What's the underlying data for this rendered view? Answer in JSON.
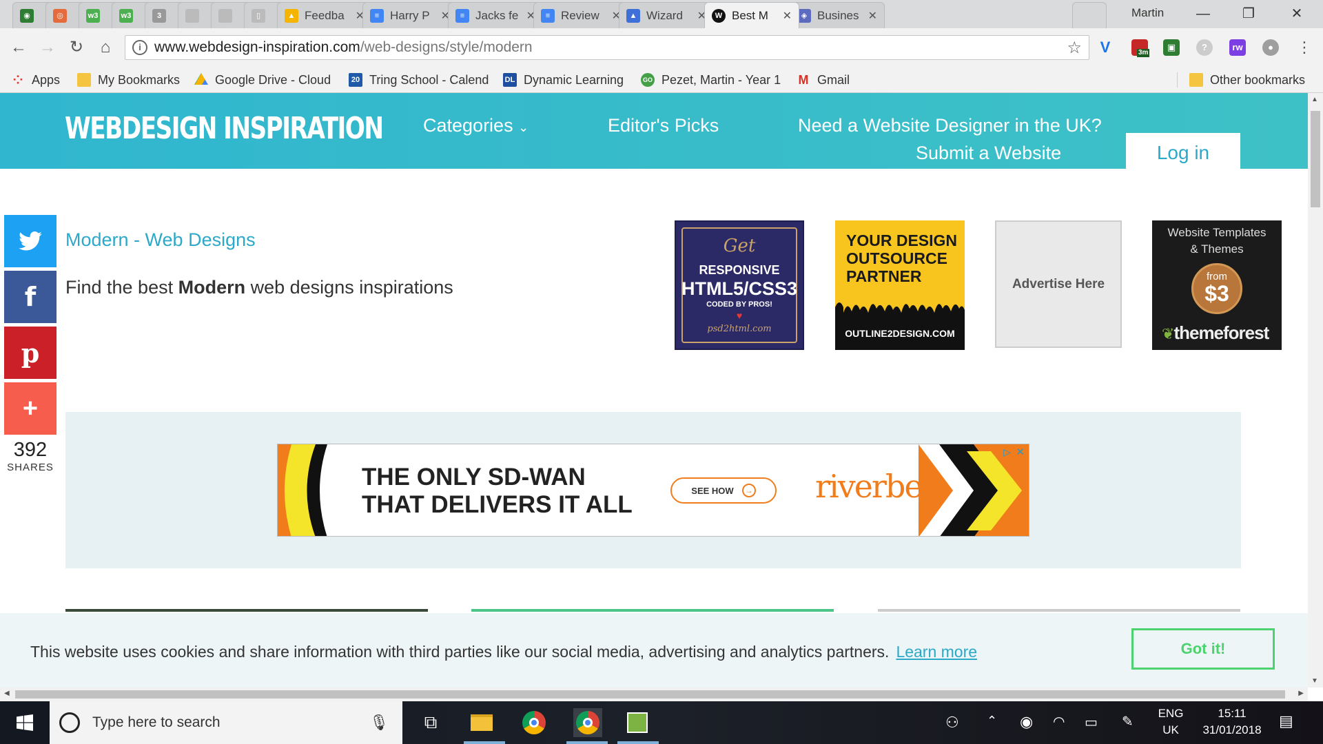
{
  "browser": {
    "tabs": [
      {
        "label": "",
        "fav": "green-person-icon",
        "color": "#2e7d32"
      },
      {
        "label": "",
        "fav": "swirl-icon",
        "color": "#e66b3c"
      },
      {
        "label": "",
        "fav": "w3-icon",
        "color": "#4caf50"
      },
      {
        "label": "",
        "fav": "w3-icon",
        "color": "#4caf50"
      },
      {
        "label": "",
        "fav": "css3-icon",
        "color": "#999999"
      },
      {
        "label": "",
        "fav": "blank-icon",
        "color": "#bbbbbb"
      },
      {
        "label": "",
        "fav": "blank-icon",
        "color": "#bbbbbb"
      },
      {
        "label": "",
        "fav": "page-icon",
        "color": "#bbbbbb"
      },
      {
        "label": "Feedba",
        "fav": "google-drive-icon",
        "color": "#f4b400"
      },
      {
        "label": "Harry P",
        "fav": "google-docs-icon",
        "color": "#4285f4"
      },
      {
        "label": "Jacks fe",
        "fav": "google-docs-icon",
        "color": "#4285f4"
      },
      {
        "label": "Review",
        "fav": "google-docs-icon",
        "color": "#4285f4"
      },
      {
        "label": "Wizard",
        "fav": "wizard-icon",
        "color": "#3f6fd8"
      },
      {
        "label": "Best M",
        "fav": "w-logo-icon",
        "color": "#111111"
      },
      {
        "label": "Busines",
        "fav": "business-icon",
        "color": "#5c6bc0"
      }
    ],
    "profile_name": "Martin",
    "url_host": "www.webdesign-inspiration.com",
    "url_path": "/web-designs/style/modern",
    "extension_badge": "3m",
    "bookmarks": [
      {
        "label": "Apps",
        "icon": "apps-grid-icon"
      },
      {
        "label": "My Bookmarks",
        "icon": "folder-icon"
      },
      {
        "label": "Google Drive - Cloud",
        "icon": "google-drive-icon"
      },
      {
        "label": "Tring School - Calend",
        "icon": "calendar-icon",
        "badge": "20"
      },
      {
        "label": "Dynamic Learning",
        "icon": "dl-icon",
        "badge": "DL"
      },
      {
        "label": "Pezet, Martin - Year 1",
        "icon": "go-icon",
        "badge": "GO"
      },
      {
        "label": "Gmail",
        "icon": "gmail-icon",
        "badge": "M"
      }
    ],
    "other_bookmarks": "Other bookmarks"
  },
  "site": {
    "logo": "WEBDESIGN INSPIRATION",
    "nav": {
      "categories": "Categories",
      "editors_picks": "Editor's Picks",
      "need_designer": "Need a Website Designer in the UK?",
      "submit": "Submit a Website",
      "login": "Log in"
    },
    "share": {
      "count": "392",
      "label": "SHARES"
    },
    "heading": "Modern - Web Designs",
    "subheading_pre": "Find the best ",
    "subheading_bold": "Modern",
    "subheading_post": " web designs inspirations",
    "ads": {
      "ad1_get": "Get",
      "ad1_line1": "RESPONSIVE",
      "ad1_line2": "HTML5/CSS3",
      "ad1_line3": "CODED BY PROS!",
      "ad1_site": "psd2html.com",
      "ad2_line1": "YOUR DESIGN",
      "ad2_line2": "OUTSOURCE",
      "ad2_line3": "PARTNER",
      "ad2_site": "OUTLINE2DESIGN.COM",
      "ad3": "Advertise Here",
      "ad4_line1": "Website Templates",
      "ad4_line2": "& Themes",
      "ad4_from": "from",
      "ad4_price": "$3",
      "ad4_brand": "themeforest"
    },
    "banner": {
      "line1": "THE ONLY SD-WAN",
      "line2": "THAT DELIVERS IT ALL",
      "cta": "SEE HOW",
      "brand": "riverbed"
    },
    "cookie": {
      "text": "This website uses cookies and share information with third parties like our social media, advertising and analytics partners.",
      "learn_more": "Learn more",
      "button": "Got it!"
    }
  },
  "taskbar": {
    "search_placeholder": "Type here to search",
    "lang1": "ENG",
    "lang2": "UK",
    "time": "15:11",
    "date": "31/01/2018"
  },
  "colors": {
    "header_start": "#30b6cf",
    "header_end": "#3ec1c6",
    "accent": "#2ca8c9",
    "twitter": "#1da1f2",
    "facebook": "#3b5998",
    "pinterest": "#cb2027",
    "more": "#f65d4d",
    "cookie_button": "#4cd26e"
  }
}
